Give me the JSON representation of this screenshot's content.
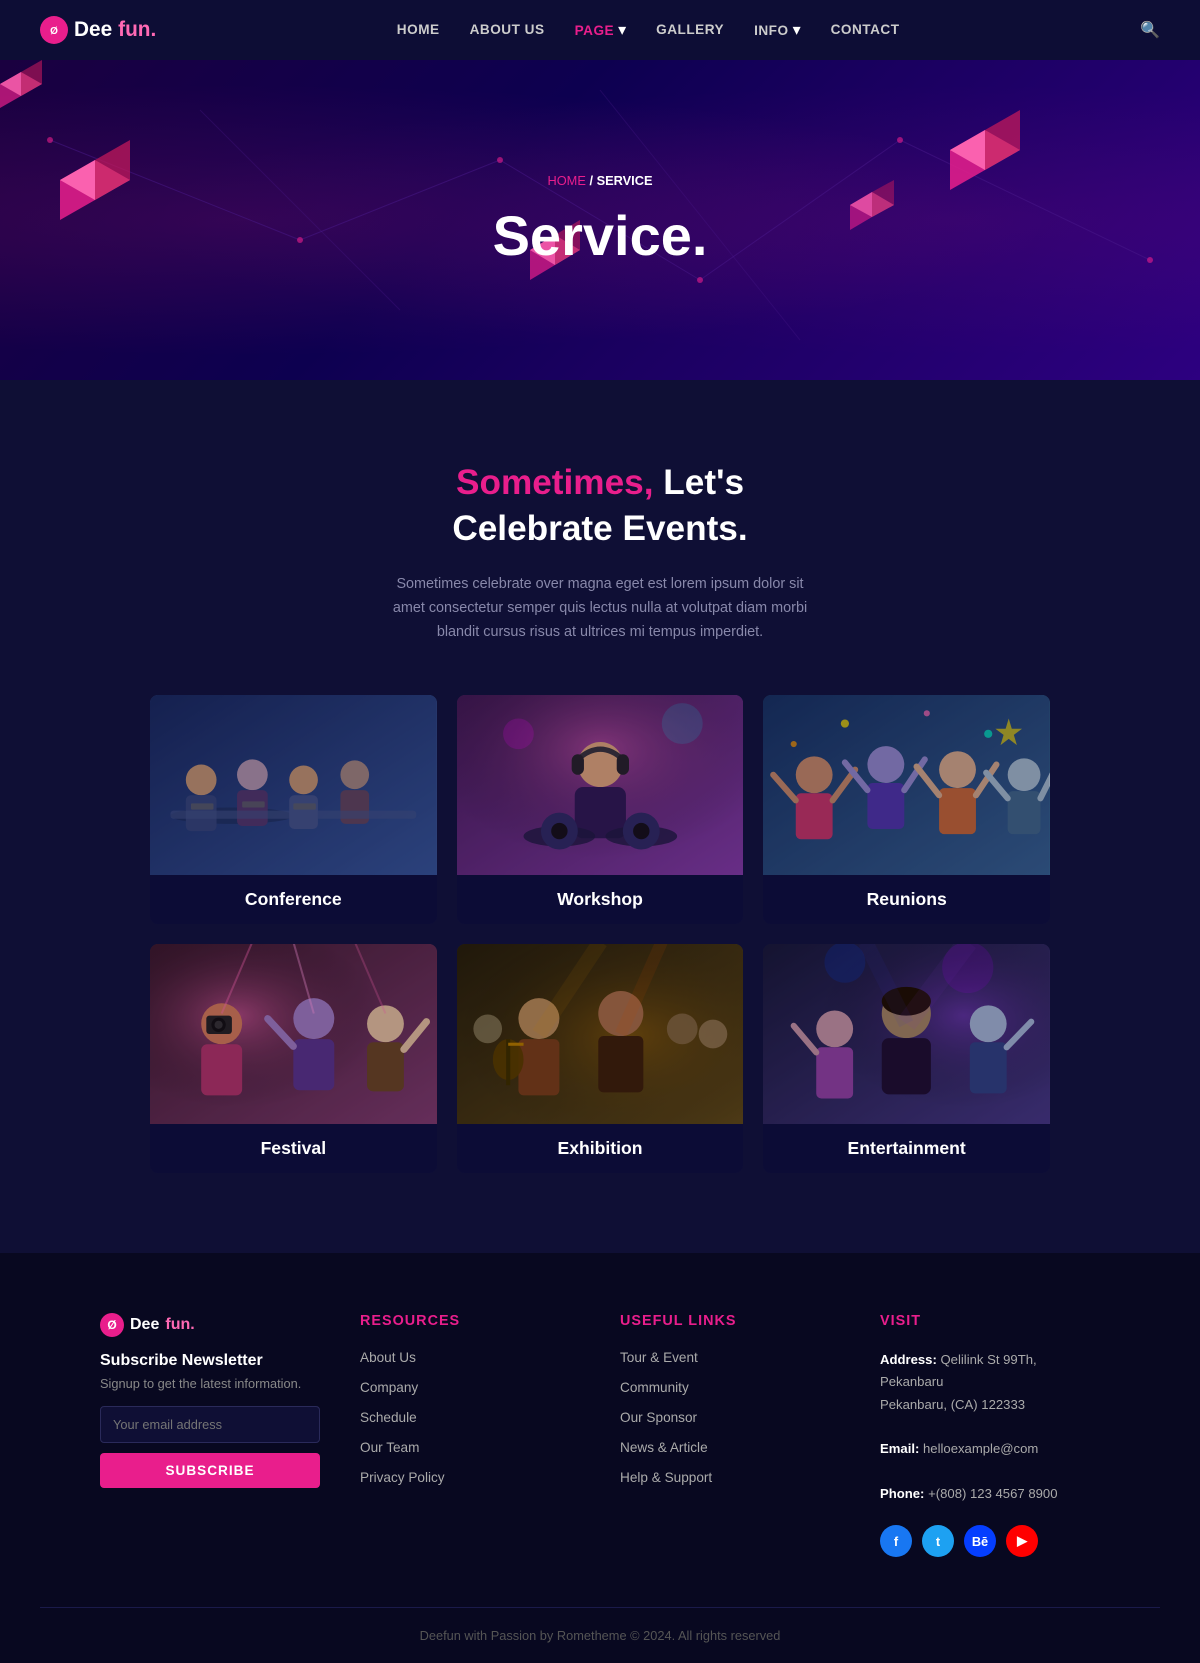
{
  "brand": {
    "icon_text": "Ø",
    "dee": "Dee",
    "fun": "fun.",
    "dot": ""
  },
  "navbar": {
    "links": [
      {
        "label": "HOME",
        "active": false,
        "has_dropdown": false
      },
      {
        "label": "ABOUT US",
        "active": false,
        "has_dropdown": false
      },
      {
        "label": "PAGE",
        "active": true,
        "has_dropdown": true
      },
      {
        "label": "GALLERY",
        "active": false,
        "has_dropdown": false
      },
      {
        "label": "INFO",
        "active": false,
        "has_dropdown": true
      },
      {
        "label": "CONTACT",
        "active": false,
        "has_dropdown": false
      }
    ]
  },
  "hero": {
    "breadcrumb_home": "HOME",
    "breadcrumb_sep": " / ",
    "breadcrumb_current": "SERVICE",
    "title": "Service."
  },
  "services": {
    "heading_highlight": "Sometimes,",
    "heading_rest": " Let's\nCelebrate Events.",
    "description": "Sometimes celebrate over magna eget est lorem ipsum dolor sit amet consectetur semper quis lectus nulla at volutpat diam morbi blandit cursus risus at ultrices mi tempus imperdiet.",
    "cards": [
      {
        "id": "conference",
        "label": "Conference",
        "emoji": "👥",
        "img_class": "img-conference"
      },
      {
        "id": "workshop",
        "label": "Workshop",
        "emoji": "🎧",
        "img_class": "img-workshop"
      },
      {
        "id": "reunions",
        "label": "Reunions",
        "emoji": "🎉",
        "img_class": "img-reunions"
      },
      {
        "id": "festival",
        "label": "Festival",
        "emoji": "📸",
        "img_class": "img-festival"
      },
      {
        "id": "exhibition",
        "label": "Exhibition",
        "emoji": "🎸",
        "img_class": "img-exhibition"
      },
      {
        "id": "entertainment",
        "label": "Entertainment",
        "emoji": "💃",
        "img_class": "img-entertainment"
      }
    ]
  },
  "footer": {
    "brand_dee": "Dee",
    "brand_fun": "fun.",
    "newsletter_title": "Subscribe Newsletter",
    "newsletter_desc": "Signup to get the latest information.",
    "email_placeholder": "Your email address",
    "subscribe_label": "SUBSCRIBE",
    "resources_title": "RESOURCES",
    "resources_links": [
      {
        "label": "About Us"
      },
      {
        "label": "Company"
      },
      {
        "label": "Schedule"
      },
      {
        "label": "Our Team"
      },
      {
        "label": "Privacy Policy"
      }
    ],
    "useful_title": "USEFUL LINKS",
    "useful_links": [
      {
        "label": "Tour & Event"
      },
      {
        "label": "Community"
      },
      {
        "label": "Our Sponsor"
      },
      {
        "label": "News & Article"
      },
      {
        "label": "Help & Support"
      }
    ],
    "visit_title": "VISIT",
    "address_label": "Address:",
    "address_value": "Qelilink St 99Th, Pekanbaru\nPekanbaru, (CA) 122333",
    "email_label": "Email:",
    "email_value": "helloexample@com",
    "phone_label": "Phone:",
    "phone_value": "+(808) 123 4567 8900",
    "copyright": "Deefun with Passion by Rometheme © 2024. All rights reserved"
  }
}
